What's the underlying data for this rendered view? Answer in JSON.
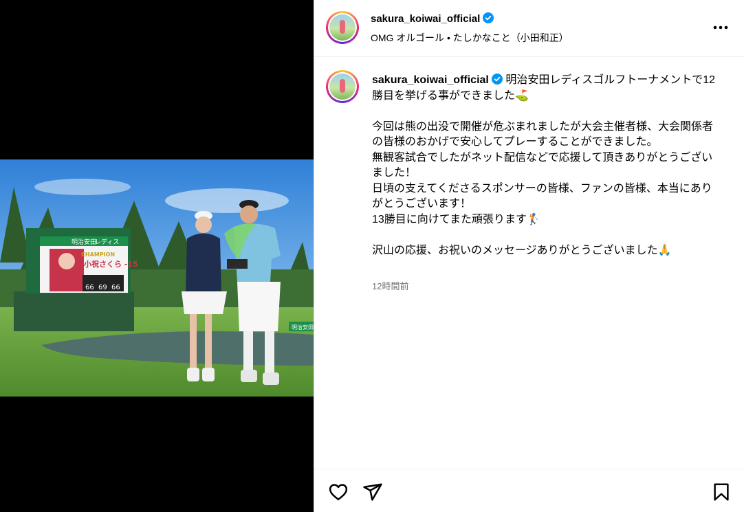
{
  "post": {
    "username": "sakura_koiwai_official",
    "audio": "OMG オルゴール • たしかなこと（小田和正）",
    "caption_lead": "明治安田レディスゴルフトーナメントで12勝目を挙げる事ができました⛳",
    "caption_body": "今回は熊の出没で開催が危ぶまれましたが大会主催者様、大会関係者の皆様のおかげで安心してプレーすることができました。\n無観客試合でしたがネット配信などで応援して頂きありがとうございました！\n日頃の支えてくださるスポンサーの皆様、ファンの皆様、本当にありがとうございます！\n13勝目に向けてまた頑張ります🏌\n\n沢山の応援、お祝いのメッセージありがとうございました🙏",
    "timestamp": "12時間前"
  },
  "photo": {
    "board_brand": "明治安田",
    "board_event": "レディス",
    "board_champion": "CHAMPION",
    "board_name": "小祝さくら -15",
    "board_scores": [
      "66",
      "69",
      "66"
    ],
    "sign_brand": "明治安田"
  },
  "icons": {
    "verified": "verified-badge-icon",
    "more": "more-options-icon",
    "like": "heart-icon",
    "share": "send-icon",
    "save": "bookmark-icon"
  },
  "colors": {
    "verified": "#0095f6",
    "timestamp": "#737373",
    "board_green": "#1f6b3f",
    "sky": "#3b8ee0",
    "grass": "#5f9b3a"
  }
}
